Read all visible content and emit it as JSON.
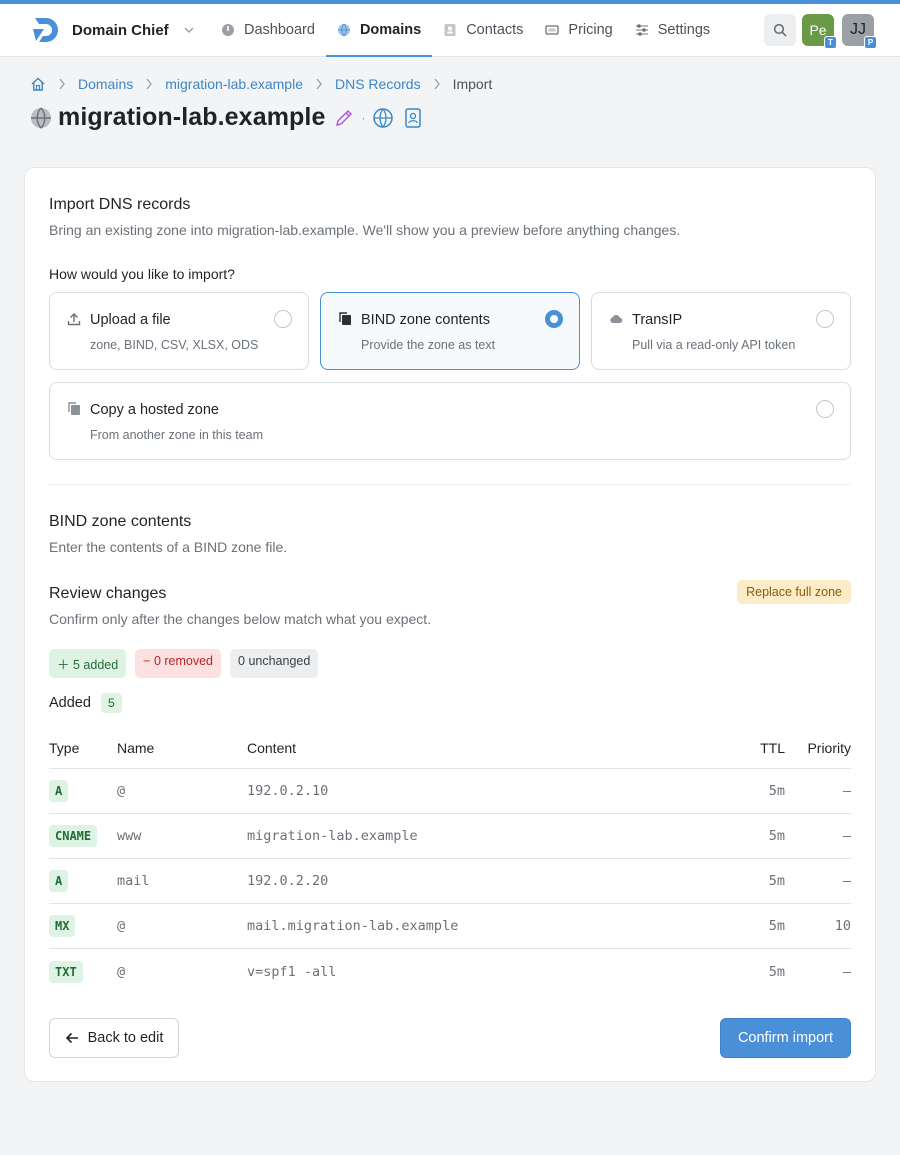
{
  "brand": {
    "name": "Domain Chief",
    "accent": "#4a90d9"
  },
  "nav": [
    {
      "label": "Dashboard",
      "icon": "dashboard-icon"
    },
    {
      "label": "Domains",
      "icon": "globe-icon"
    },
    {
      "label": "Contacts",
      "icon": "contact-card-icon"
    },
    {
      "label": "Pricing",
      "icon": "ticket-icon"
    },
    {
      "label": "Settings",
      "icon": "sliders-icon"
    }
  ],
  "avatars": [
    {
      "initials": "Pe",
      "badge": "T",
      "color": "#6a9a48"
    },
    {
      "initials": "JJ",
      "badge": "P",
      "color": "#9aa0a6"
    }
  ],
  "breadcrumb": {
    "d": "Domains",
    "z": "migration-lab.example",
    "r": "DNS Records",
    "c": "Import"
  },
  "page": {
    "title": "migration-lab.example"
  },
  "import": {
    "heading": "Import DNS records",
    "description": "Bring an existing zone into migration-lab.example. We'll show you a preview before anything changes.",
    "question": "How would you like to import?",
    "options": [
      {
        "title": "Upload a file",
        "subtitle": "zone, BIND, CSV, XLSX, ODS",
        "icon": "upload-icon"
      },
      {
        "title": "BIND zone contents",
        "subtitle": "Provide the zone as text",
        "icon": "copy-icon"
      },
      {
        "title": "TransIP",
        "subtitle": "Pull via a read-only API token",
        "icon": "cloud-icon"
      },
      {
        "title": "Copy a hosted zone",
        "subtitle": "From another zone in this team",
        "icon": "copy-zone-icon"
      }
    ],
    "selected": "BIND zone contents"
  },
  "bind": {
    "heading": "BIND zone contents",
    "description": "Enter the contents of a BIND zone file."
  },
  "review": {
    "heading": "Review changes",
    "description": "Confirm only after the changes below match what you expect.",
    "mode": "Replace full zone",
    "added": "5 added",
    "removed": "0 removed",
    "unchanged": "0 unchanged",
    "added_label": "Added",
    "added_count": "5"
  },
  "table": {
    "headers": {
      "type": "Type",
      "name": "Name",
      "content": "Content",
      "ttl": "TTL",
      "priority": "Priority"
    },
    "rows": [
      {
        "type": "A",
        "name": "@",
        "content": "192.0.2.10",
        "ttl": "5m",
        "priority": "—"
      },
      {
        "type": "CNAME",
        "name": "www",
        "content": "migration-lab.example",
        "ttl": "5m",
        "priority": "—"
      },
      {
        "type": "A",
        "name": "mail",
        "content": "192.0.2.20",
        "ttl": "5m",
        "priority": "—"
      },
      {
        "type": "MX",
        "name": "@",
        "content": "mail.migration-lab.example",
        "ttl": "5m",
        "priority": "10"
      },
      {
        "type": "TXT",
        "name": "@",
        "content": "v=spf1 -all",
        "ttl": "5m",
        "priority": "—"
      }
    ]
  },
  "actions": {
    "back": "Back to edit",
    "confirm": "Confirm import"
  }
}
